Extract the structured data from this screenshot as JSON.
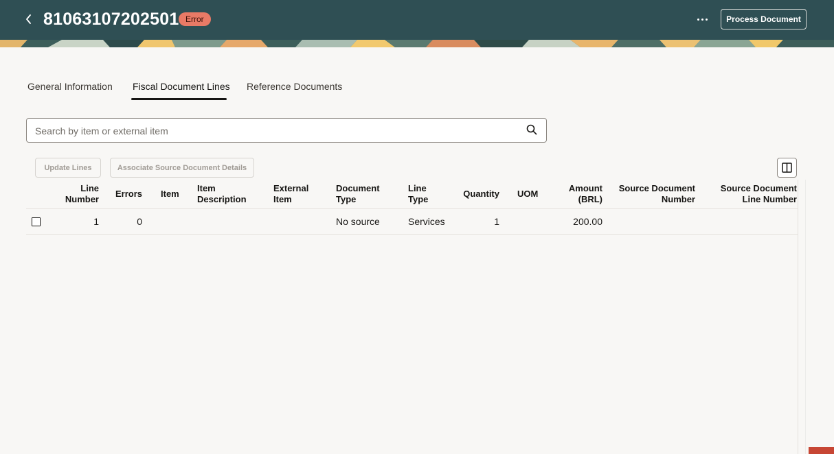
{
  "header": {
    "title": "81063107202501",
    "status": "Error",
    "process_label": "Process Document",
    "back_icon": "chevron-left-icon",
    "more_icon": "more-horizontal-icon"
  },
  "tabs": [
    {
      "label": "General Information"
    },
    {
      "label": "Fiscal Document Lines"
    },
    {
      "label": "Reference Documents"
    }
  ],
  "active_tab": "Fiscal Document Lines",
  "search": {
    "placeholder": "Search by item or external item",
    "value": ""
  },
  "toolbar": {
    "update_lines_label": "Update Lines",
    "associate_label": "Associate Source Document Details",
    "columns_icon": "columns-icon"
  },
  "table": {
    "columns": [
      {
        "line1": "Line",
        "line2": "Number"
      },
      {
        "line1": "Errors",
        "line2": ""
      },
      {
        "line1": "Item",
        "line2": ""
      },
      {
        "line1": "Item",
        "line2": "Description"
      },
      {
        "line1": "External",
        "line2": "Item"
      },
      {
        "line1": "Document",
        "line2": "Type"
      },
      {
        "line1": "Line",
        "line2": "Type"
      },
      {
        "line1": "Quantity",
        "line2": ""
      },
      {
        "line1": "UOM",
        "line2": ""
      },
      {
        "line1": "Amount",
        "line2": "(BRL)"
      },
      {
        "line1": "Source Document",
        "line2": "Number"
      },
      {
        "line1": "Source Document",
        "line2": "Line Number"
      }
    ],
    "rows": [
      {
        "line_number": "1",
        "errors": "0",
        "item": "",
        "item_description": "",
        "external_item": "",
        "document_type": "No source",
        "line_type": "Services",
        "quantity": "1",
        "uom": "",
        "amount": "200.00",
        "source_document_number": "",
        "source_document_line_number": "",
        "selected": false
      }
    ]
  },
  "colors": {
    "header_bg": "#2f4f54",
    "status_badge": "#e97a66",
    "page_bg": "#f8f7f5",
    "accent_red": "#c74634"
  }
}
